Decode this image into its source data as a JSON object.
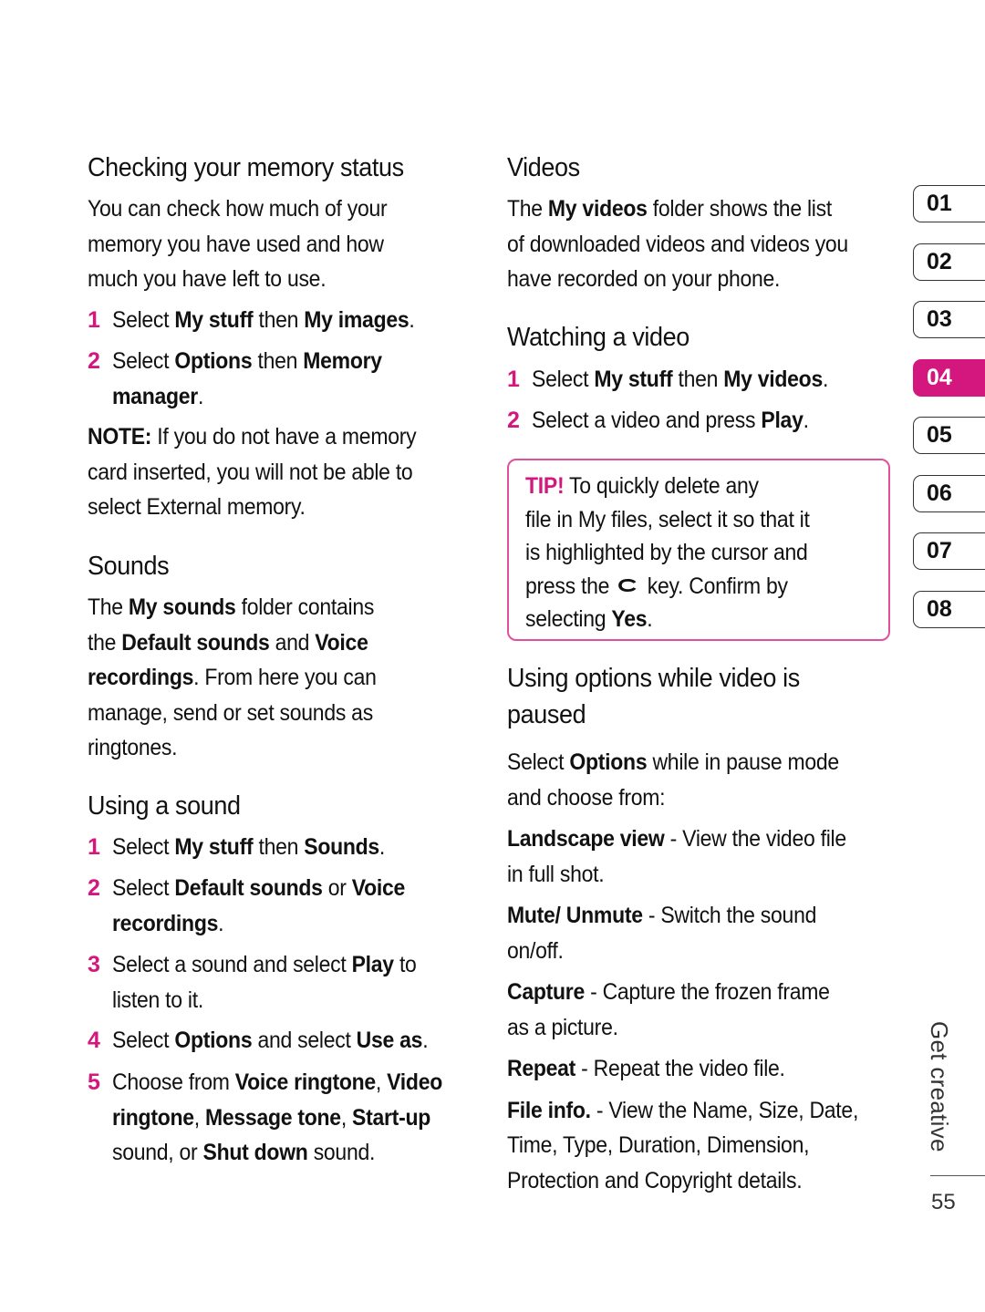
{
  "colors": {
    "accent": "#d4177e",
    "tip_border": "#e0509c",
    "text": "#111111"
  },
  "left": {
    "memory": {
      "heading": "Checking your memory status",
      "intro_lines": [
        "You can check how much of your",
        "memory you have used and how",
        "much you have left to use."
      ],
      "steps": [
        {
          "num": "1",
          "a": "Select ",
          "b1": "My stuff",
          "c": " then ",
          "b2": "My images",
          "d": "."
        },
        {
          "num": "2",
          "a": "Select ",
          "b1": "Options",
          "c": " then ",
          "b2": "Memory",
          "line2_b": "manager",
          "line2_d": "."
        }
      ],
      "note": {
        "label": "NOTE:",
        "line1": " If you do not have a memory",
        "line2": "card inserted, you will not be able to",
        "line3": "select External memory."
      }
    },
    "sounds": {
      "heading": "Sounds",
      "l1_a": "The ",
      "l1_b": "My sounds",
      "l1_c": " folder contains",
      "l2_a": "the ",
      "l2_b": "Default sounds",
      "l2_c": " and ",
      "l2_d": "Voice",
      "l3_b": "recordings",
      "l3_c": ". From here you can",
      "l4": "manage, send or set sounds as",
      "l5": "ringtones."
    },
    "using_sound": {
      "heading": "Using a sound",
      "step1": {
        "num": "1",
        "a": "Select ",
        "b1": "My stuff",
        "c": " then ",
        "b2": "Sounds",
        "d": "."
      },
      "step2": {
        "num": "2",
        "a": "Select ",
        "b1": "Default sounds",
        "c": " or ",
        "b2": "Voice",
        "line2_b": "recordings",
        "line2_d": "."
      },
      "step3": {
        "num": "3",
        "a": "Select a sound and select ",
        "b1": "Play",
        "c": " to",
        "line2": "listen to it."
      },
      "step4": {
        "num": "4",
        "a": "Select ",
        "b1": "Options",
        "c": " and select ",
        "b2": "Use as",
        "d": "."
      },
      "step5": {
        "num": "5",
        "a": "Choose from ",
        "b1": "Voice ringtone",
        "c": ", ",
        "b2": "Video",
        "l2_b1": "ringtone",
        "l2_c": ", ",
        "l2_b2": "Message tone",
        "l2_d": ", ",
        "l2_b3": "Start-up",
        "l3_a": "sound, or ",
        "l3_b": "Shut down",
        "l3_c": " sound."
      }
    }
  },
  "right": {
    "videos": {
      "heading": "Videos",
      "l1_a": "The ",
      "l1_b": "My videos",
      "l1_c": " folder shows the list",
      "l2": "of downloaded videos and videos you",
      "l3": "have recorded on your phone."
    },
    "watching": {
      "heading": "Watching a video",
      "step1": {
        "num": "1",
        "a": "Select ",
        "b1": "My stuff",
        "c": " then ",
        "b2": "My videos",
        "d": "."
      },
      "step2": {
        "num": "2",
        "a": "Select a video and press ",
        "b1": "Play",
        "d": "."
      }
    },
    "tip": {
      "label": "TIP!",
      "l1": " To quickly delete any",
      "l2": "file in My files, select it so that it",
      "l3": "is highlighted by the cursor and",
      "l4_a": "press the ",
      "key_icon": "c-key-icon",
      "l4_b": " key. Confirm by",
      "l5_a": "selecting ",
      "l5_b": "Yes",
      "l5_c": "."
    },
    "options": {
      "heading_l1": "Using options while video is",
      "heading_l2": "paused",
      "intro_a": "Select ",
      "intro_b": "Options",
      "intro_c": " while in pause mode",
      "intro_l2": "and choose from:",
      "items": [
        {
          "term": "Landscape view",
          "l1": " - View the video file",
          "l2": "in full shot."
        },
        {
          "term": "Mute/ Unmute",
          "l1": " - Switch the sound",
          "l2": "on/off."
        },
        {
          "term": "Capture",
          "l1": " - Capture the frozen frame",
          "l2": "as a picture."
        },
        {
          "term": "Repeat",
          "l1": " - Repeat the video file.",
          "l2": ""
        },
        {
          "term": "File info.",
          "l1": " - View the Name, Size, Date,",
          "l2": "Time, Type, Duration, Dimension,",
          "l3": "Protection and Copyright details."
        }
      ]
    }
  },
  "chapter_tabs": [
    {
      "label": "01",
      "active": false
    },
    {
      "label": "02",
      "active": false
    },
    {
      "label": "03",
      "active": false
    },
    {
      "label": "04",
      "active": true
    },
    {
      "label": "05",
      "active": false
    },
    {
      "label": "06",
      "active": false
    },
    {
      "label": "07",
      "active": false
    },
    {
      "label": "08",
      "active": false
    }
  ],
  "section_title": "Get creative",
  "page_number": "55"
}
